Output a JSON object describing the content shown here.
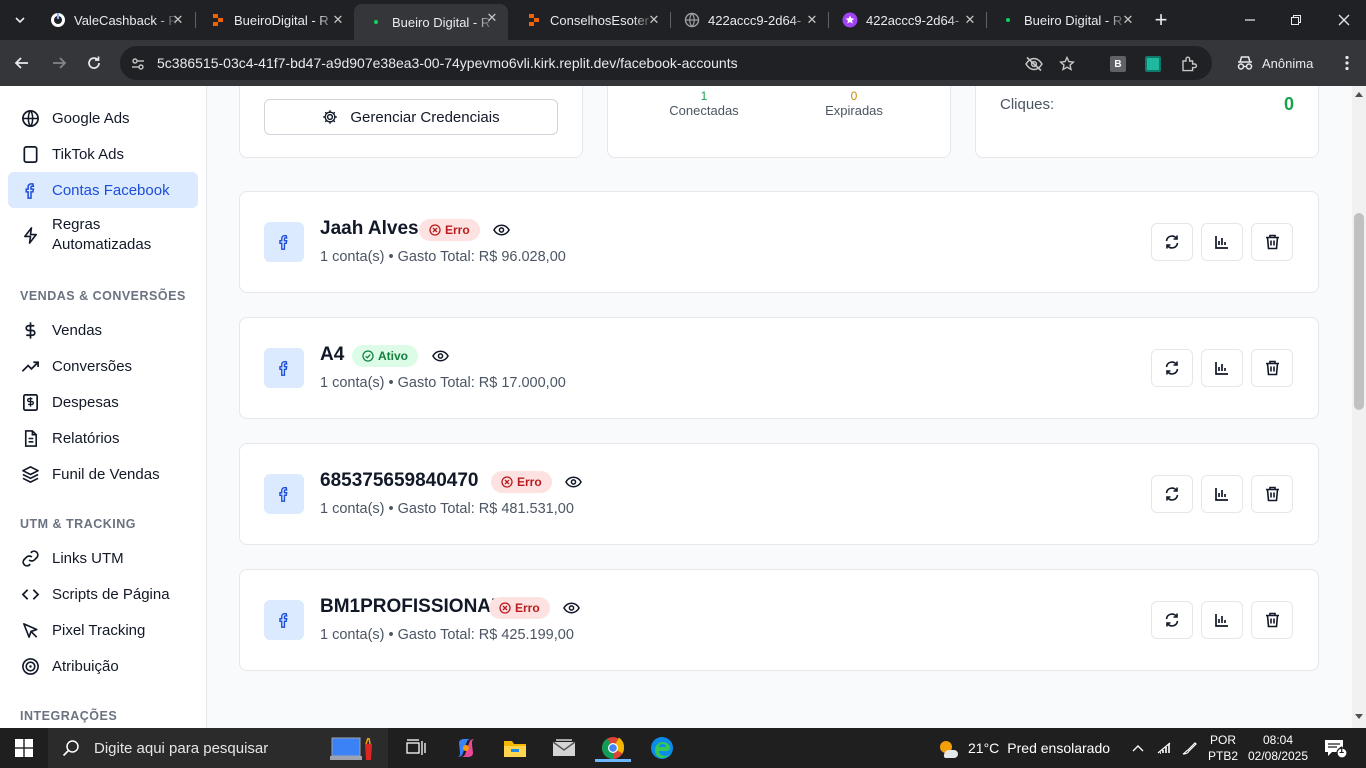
{
  "browser": {
    "tabs": [
      {
        "label": "ValeCashback - R",
        "icon": "github-icon",
        "active": false
      },
      {
        "label": "BueiroDigital - R",
        "icon": "replit-icon",
        "active": false
      },
      {
        "label": "Bueiro Digital - R",
        "icon": "replit-dot-icon",
        "active": true
      },
      {
        "label": "ConselhosEsoter",
        "icon": "replit-icon",
        "active": false
      },
      {
        "label": "422accc9-2d64-",
        "icon": "globe-icon",
        "active": false
      },
      {
        "label": "422accc9-2d64-",
        "icon": "star-icon",
        "active": false
      },
      {
        "label": "Bueiro Digital - R",
        "icon": "replit-dot-icon",
        "active": false
      }
    ],
    "url": "5c386515-03c4-41f7-bd47-a9d907e38ea3-00-74ypevmo6vli.kirk.replit.dev/facebook-accounts",
    "profile_label": "Anônima"
  },
  "sidebar": {
    "top_items": [
      {
        "label": "Google Ads",
        "icon": "globe-icon"
      },
      {
        "label": "TikTok Ads",
        "icon": "phone-icon"
      },
      {
        "label": "Contas Facebook",
        "icon": "facebook-icon",
        "active": true
      },
      {
        "label": "Regras Automatizadas",
        "icon": "zap-icon"
      }
    ],
    "sales_title": "VENDAS & CONVERSÕES",
    "sales_items": [
      {
        "label": "Vendas",
        "icon": "dollar-icon"
      },
      {
        "label": "Conversões",
        "icon": "trending-up-icon"
      },
      {
        "label": "Despesas",
        "icon": "receipt-icon"
      },
      {
        "label": "Relatórios",
        "icon": "file-icon"
      },
      {
        "label": "Funil de Vendas",
        "icon": "layers-icon"
      }
    ],
    "utm_title": "UTM & TRACKING",
    "utm_items": [
      {
        "label": "Links UTM",
        "icon": "link-icon"
      },
      {
        "label": "Scripts de Página",
        "icon": "code-icon"
      },
      {
        "label": "Pixel Tracking",
        "icon": "cursor-icon"
      },
      {
        "label": "Atribuição",
        "icon": "target-icon"
      }
    ],
    "integrations_title": "INTEGRAÇÕES"
  },
  "top_cards": {
    "manage_credentials_label": "Gerenciar Credenciais",
    "connected_value": "1",
    "connected_label": "Conectadas",
    "expired_value": "0",
    "expired_label": "Expiradas",
    "clicks_label": "Cliques:",
    "clicks_value": "0"
  },
  "accounts": [
    {
      "name": "Jaah Alves",
      "status": "Erro",
      "status_type": "error",
      "count": "1 conta(s)",
      "spend": "Gasto Total: R$ 96.028,00"
    },
    {
      "name": "A4",
      "status": "Ativo",
      "status_type": "active",
      "count": "1 conta(s)",
      "spend": "Gasto Total: R$ 17.000,00"
    },
    {
      "name": "685375659840470",
      "status": "Erro",
      "status_type": "error",
      "count": "1 conta(s)",
      "spend": "Gasto Total: R$ 481.531,00"
    },
    {
      "name": "BM1PROFISSIONAL",
      "status": "Erro",
      "status_type": "error",
      "count": "1 conta(s)",
      "spend": "Gasto Total: R$ 425.199,00"
    }
  ],
  "taskbar": {
    "search_placeholder": "Digite aqui para pesquisar",
    "weather_temp": "21°C",
    "weather_desc": "Pred ensolarado",
    "lang_top": "POR",
    "lang_bottom": "PTB2",
    "time": "08:04",
    "date": "02/08/2025",
    "notification_count": "1"
  },
  "colors": {
    "accent_blue": "#1d4ed8",
    "active_bg": "#dbeafe",
    "error_red": "#b91c1c",
    "success_green": "#15803d",
    "clicks_green": "#16a34a",
    "expired_orange": "#ca8a04"
  }
}
